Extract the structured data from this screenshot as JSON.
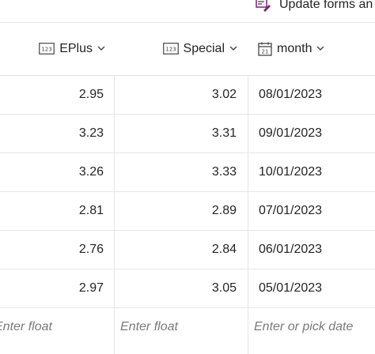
{
  "toolbar": {
    "update_forms_label": "Update forms an",
    "update_forms_icon": "form-edit-icon"
  },
  "columns": [
    {
      "label": "EPlus",
      "icon": "number-type-icon"
    },
    {
      "label": "Special",
      "icon": "number-type-icon"
    },
    {
      "label": "month",
      "icon": "calendar-icon",
      "calendar_day": "21"
    }
  ],
  "number_icon_text": "123",
  "rows": [
    {
      "eplus": "2.95",
      "special": "3.02",
      "month": "08/01/2023"
    },
    {
      "eplus": "3.23",
      "special": "3.31",
      "month": "09/01/2023"
    },
    {
      "eplus": "3.26",
      "special": "3.33",
      "month": "10/01/2023"
    },
    {
      "eplus": "2.81",
      "special": "2.89",
      "month": "07/01/2023"
    },
    {
      "eplus": "2.76",
      "special": "2.84",
      "month": "06/01/2023"
    },
    {
      "eplus": "2.97",
      "special": "3.05",
      "month": "05/01/2023"
    }
  ],
  "new_row": {
    "eplus_placeholder": "Enter float",
    "special_placeholder": "Enter float",
    "month_placeholder": "Enter or pick date"
  },
  "colors": {
    "accent": "#742774",
    "grid_line": "#e6e6e6",
    "placeholder": "#7a7a7a"
  }
}
